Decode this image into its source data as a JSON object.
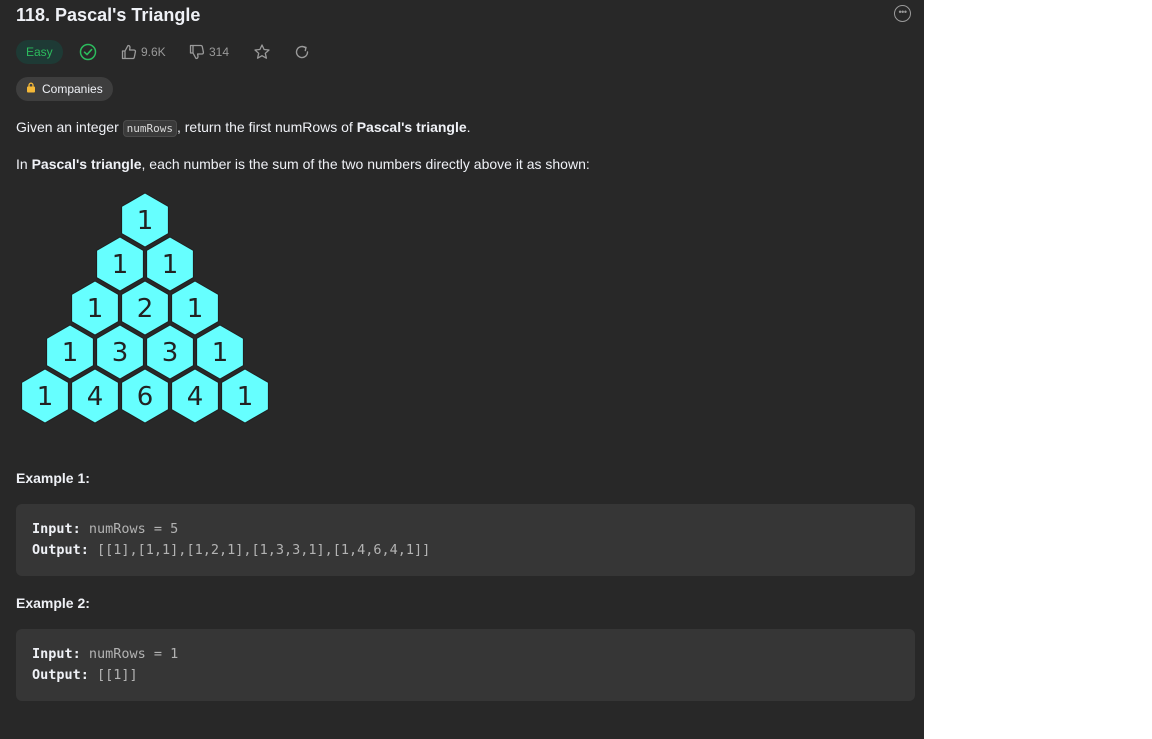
{
  "problem": {
    "title": "118. Pascal's Triangle",
    "difficulty": "Easy",
    "likes": "9.6K",
    "dislikes": "314",
    "companies_label": "Companies"
  },
  "description": {
    "p1_pre": "Given an integer ",
    "p1_code": "numRows",
    "p1_mid": ", return the first numRows of ",
    "p1_bold": "Pascal's triangle",
    "p1_post": ".",
    "p2_pre": "In ",
    "p2_bold": "Pascal's triangle",
    "p2_post": ", each number is the sum of the two numbers directly above it as shown:"
  },
  "triangle": {
    "rows": [
      [
        "1"
      ],
      [
        "1",
        "1"
      ],
      [
        "1",
        "2",
        "1"
      ],
      [
        "1",
        "3",
        "3",
        "1"
      ],
      [
        "1",
        "4",
        "6",
        "4",
        "1"
      ]
    ],
    "fill": "#66ffff",
    "stroke": "#ffffff",
    "text_color": "#222222"
  },
  "examples": [
    {
      "heading": "Example 1:",
      "input_label": "Input:",
      "input_value": " numRows = 5",
      "output_label": "Output:",
      "output_value": " [[1],[1,1],[1,2,1],[1,3,3,1],[1,4,6,4,1]]"
    },
    {
      "heading": "Example 2:",
      "input_label": "Input:",
      "input_value": " numRows = 1",
      "output_label": "Output:",
      "output_value": " [[1]]"
    }
  ],
  "colors": {
    "panel_bg": "#282828",
    "easy_green": "#2cbb5d",
    "muted": "#9a9a9a"
  }
}
